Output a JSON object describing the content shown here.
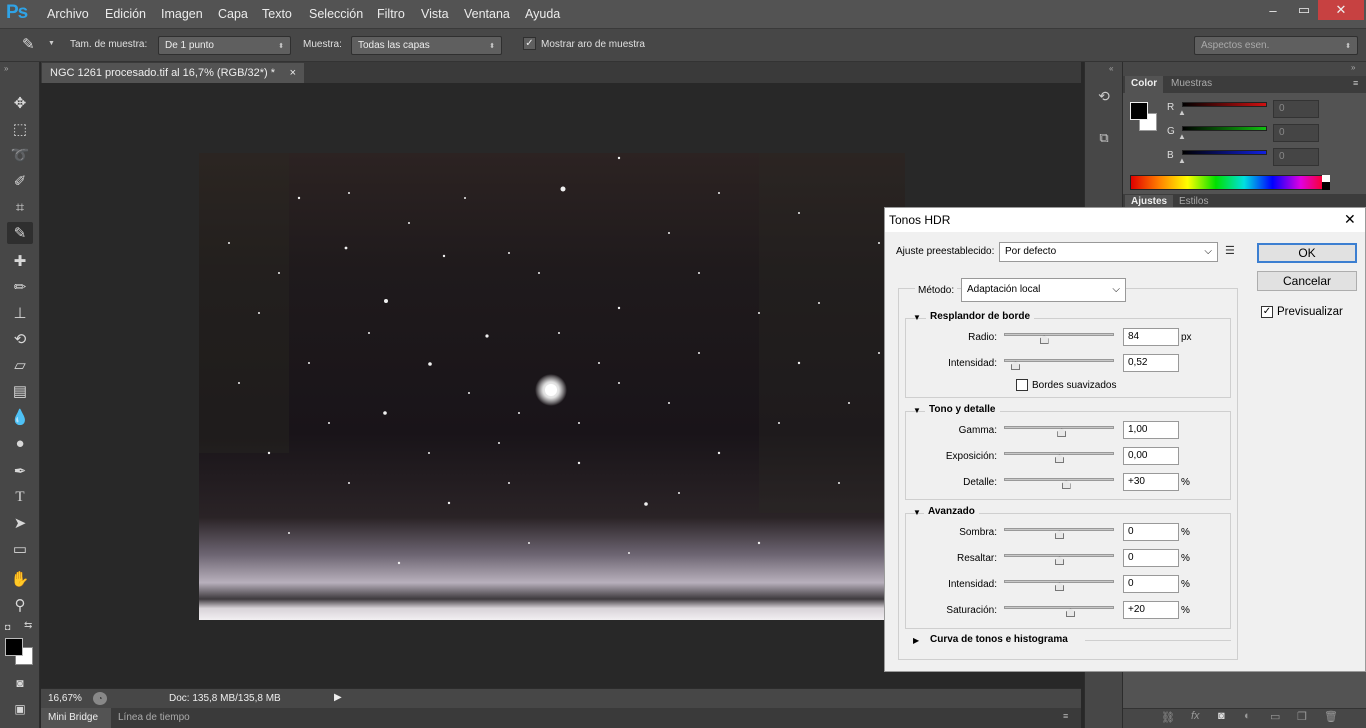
{
  "app": {
    "logo": "Ps"
  },
  "menu": [
    "Archivo",
    "Edición",
    "Imagen",
    "Capa",
    "Texto",
    "Selección",
    "Filtro",
    "Vista",
    "Ventana",
    "Ayuda"
  ],
  "window_controls": {
    "minimize": "–",
    "maximize": "▭",
    "close": "✕"
  },
  "options": {
    "sample_size_label": "Tam. de muestra:",
    "sample_size_value": "De 1 punto",
    "sample_label": "Muestra:",
    "sample_value": "Todas las capas",
    "show_ring_label": "Mostrar aro de muestra",
    "show_ring_checked": true,
    "workspace": "Aspectos esen."
  },
  "document": {
    "tab_title": "NGC 1261 procesado.tif al 16,7% (RGB/32*) *",
    "tab_close": "×",
    "zoom": "16,67%",
    "doc_info": "Doc: 135,8 MB/135,8 MB"
  },
  "bottom_tabs": [
    "Mini Bridge",
    "Línea de tiempo"
  ],
  "color_panel": {
    "tabs": [
      "Color",
      "Muestras"
    ],
    "channels": [
      {
        "label": "R",
        "value": "0",
        "color": "#d01010"
      },
      {
        "label": "G",
        "value": "0",
        "color": "#10c010"
      },
      {
        "label": "B",
        "value": "0",
        "color": "#1020e0"
      }
    ]
  },
  "adjust_panel": {
    "tabs": [
      "Ajustes",
      "Estilos"
    ]
  },
  "dialog": {
    "title": "Tonos HDR",
    "close": "✕",
    "preset_label": "Ajuste preestablecido:",
    "preset_value": "Por defecto",
    "method_label": "Método:",
    "method_value": "Adaptación local",
    "ok": "OK",
    "cancel": "Cancelar",
    "preview_label": "Previsualizar",
    "preview_checked": true,
    "edge_glow": {
      "title": "Resplandor de borde",
      "radius": {
        "label": "Radio:",
        "value": "84",
        "unit": "px",
        "level": 0.36
      },
      "strength": {
        "label": "Intensidad:",
        "value": "0,52",
        "unit": "",
        "level": 0.1
      },
      "smooth_label": "Bordes suavizados"
    },
    "tone_detail": {
      "title": "Tono y detalle",
      "rows": [
        {
          "label": "Gamma:",
          "value": "1,00",
          "unit": "",
          "level": 0.52
        },
        {
          "label": "Exposición:",
          "value": "0,00",
          "unit": "",
          "level": 0.5
        },
        {
          "label": "Detalle:",
          "value": "+30",
          "unit": "%",
          "level": 0.56
        }
      ]
    },
    "advanced": {
      "title": "Avanzado",
      "rows": [
        {
          "label": "Sombra:",
          "value": "0",
          "unit": "%",
          "level": 0.5
        },
        {
          "label": "Resaltar:",
          "value": "0",
          "unit": "%",
          "level": 0.5
        },
        {
          "label": "Intensidad:",
          "value": "0",
          "unit": "%",
          "level": 0.5
        },
        {
          "label": "Saturación:",
          "value": "+20",
          "unit": "%",
          "level": 0.6
        }
      ]
    },
    "curve_title": "Curva de tonos e histograma"
  }
}
